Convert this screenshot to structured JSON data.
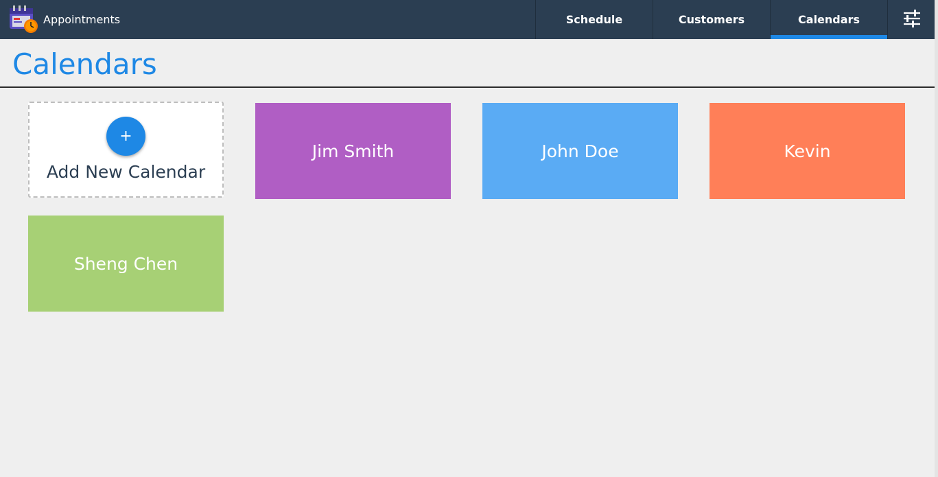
{
  "app": {
    "title": "Appointments"
  },
  "nav": {
    "tabs": [
      {
        "label": "Schedule",
        "active": false
      },
      {
        "label": "Customers",
        "active": false
      },
      {
        "label": "Calendars",
        "active": true
      }
    ],
    "settings_icon": "sliders-icon"
  },
  "page": {
    "title": "Calendars"
  },
  "add_card": {
    "icon": "+",
    "label": "Add New Calendar"
  },
  "calendars": [
    {
      "name": "Jim Smith",
      "color": "#b05ec4"
    },
    {
      "name": "John Doe",
      "color": "#5aabf4"
    },
    {
      "name": "Kevin",
      "color": "#ff7f58"
    },
    {
      "name": "Sheng Chen",
      "color": "#a7d075"
    }
  ],
  "colors": {
    "topbar": "#2b3e52",
    "accent": "#1e88e5",
    "background": "#efefef"
  }
}
